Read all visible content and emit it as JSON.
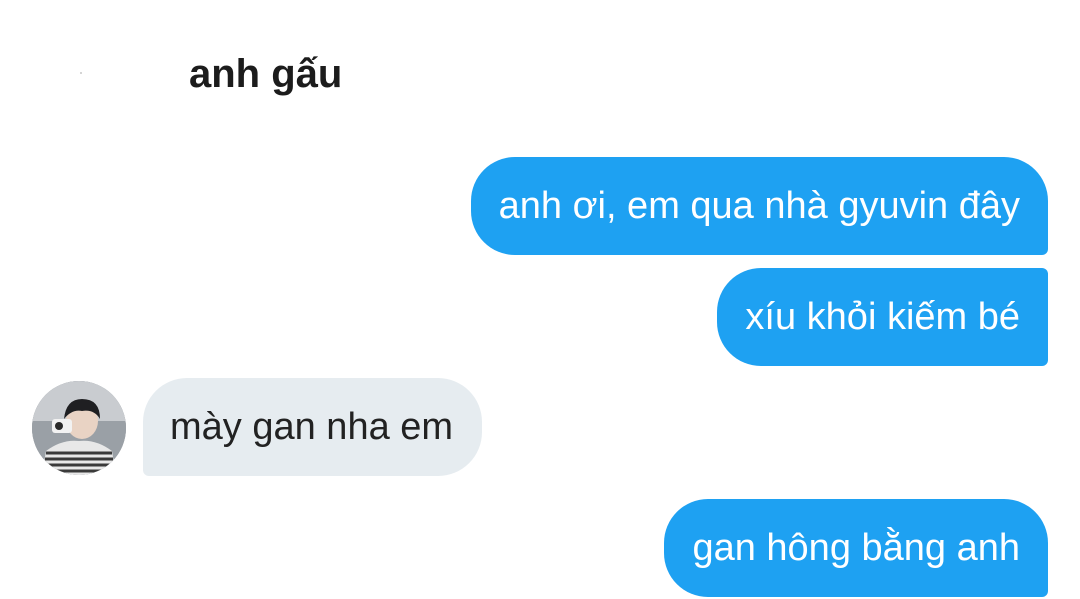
{
  "header": {
    "contact_name": "anh gấu"
  },
  "messages": [
    {
      "direction": "sent",
      "text": "anh ơi, em qua nhà gyuvin đây"
    },
    {
      "direction": "sent",
      "text": "xíu khỏi kiếm bé"
    },
    {
      "direction": "received",
      "text": "mày gan nha em"
    },
    {
      "direction": "sent",
      "text": "gan hông bằng anh"
    }
  ],
  "colors": {
    "sent_bubble": "#1ea1f2",
    "received_bubble": "#e6ecf0",
    "sent_text": "#ffffff",
    "received_text": "#222222"
  }
}
